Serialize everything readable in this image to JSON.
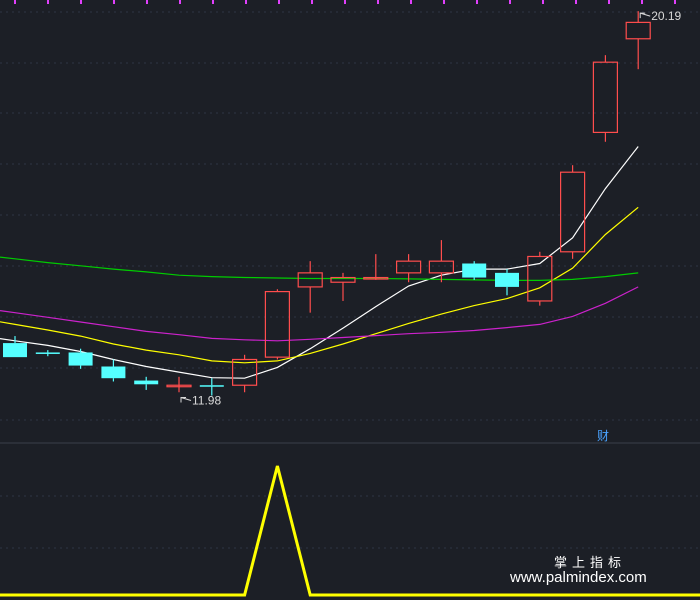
{
  "chart_data": {
    "type": "candlestick",
    "main": {
      "price_range": [
        11.5,
        20.3
      ],
      "candles": [
        {
          "open": 13.1,
          "high": 13.25,
          "low": 12.8,
          "close": 12.8
        },
        {
          "open": 12.9,
          "high": 12.95,
          "low": 12.82,
          "close": 12.88
        },
        {
          "open": 12.9,
          "high": 12.98,
          "low": 12.55,
          "close": 12.62
        },
        {
          "open": 12.6,
          "high": 12.75,
          "low": 12.28,
          "close": 12.35
        },
        {
          "open": 12.3,
          "high": 12.38,
          "low": 12.1,
          "close": 12.22
        },
        {
          "open": 12.2,
          "high": 12.38,
          "low": 12.05,
          "close": 12.2
        },
        {
          "open": 12.2,
          "high": 12.35,
          "low": 11.98,
          "close": 12.19
        },
        {
          "open": 12.2,
          "high": 12.85,
          "low": 12.05,
          "close": 12.75
        },
        {
          "open": 12.8,
          "high": 14.25,
          "low": 12.75,
          "close": 14.2
        },
        {
          "open": 14.3,
          "high": 14.85,
          "low": 13.75,
          "close": 14.6
        },
        {
          "open": 14.4,
          "high": 14.6,
          "low": 14.0,
          "close": 14.5
        },
        {
          "open": 14.5,
          "high": 15.0,
          "low": 14.45,
          "close": 14.5
        },
        {
          "open": 14.6,
          "high": 15.0,
          "low": 14.4,
          "close": 14.85
        },
        {
          "open": 14.6,
          "high": 15.3,
          "low": 14.4,
          "close": 14.85
        },
        {
          "open": 14.8,
          "high": 14.85,
          "low": 14.45,
          "close": 14.5
        },
        {
          "open": 14.6,
          "high": 14.68,
          "low": 14.12,
          "close": 14.3
        },
        {
          "open": 14.0,
          "high": 15.05,
          "low": 13.9,
          "close": 14.95
        },
        {
          "open": 15.05,
          "high": 16.9,
          "low": 14.9,
          "close": 16.75
        },
        {
          "open": 17.6,
          "high": 19.25,
          "low": 17.4,
          "close": 19.1
        },
        {
          "open": 19.6,
          "high": 20.19,
          "low": 18.95,
          "close": 19.95
        }
      ],
      "ma_lines": [
        {
          "color": "#ffffff",
          "values": [
            13.15,
            13.05,
            12.92,
            12.75,
            12.6,
            12.48,
            12.36,
            12.35,
            12.58,
            12.98,
            13.42,
            13.88,
            14.32,
            14.55,
            14.68,
            14.68,
            14.8,
            15.35,
            16.4,
            17.3
          ]
        },
        {
          "open": null,
          "color": "#ffff00",
          "values": [
            13.5,
            13.38,
            13.25,
            13.08,
            12.95,
            12.85,
            12.72,
            12.68,
            12.72,
            12.88,
            13.08,
            13.3,
            13.52,
            13.72,
            13.9,
            14.05,
            14.28,
            14.7,
            15.42,
            16.0
          ]
        },
        {
          "color": "#00cc00",
          "values": [
            14.9,
            14.82,
            14.75,
            14.68,
            14.62,
            14.55,
            14.52,
            14.5,
            14.49,
            14.48,
            14.48,
            14.48,
            14.47,
            14.46,
            14.45,
            14.44,
            14.44,
            14.46,
            14.52,
            14.6
          ]
        },
        {
          "color": "#cc22cc",
          "values": [
            13.75,
            13.65,
            13.55,
            13.45,
            13.35,
            13.28,
            13.2,
            13.17,
            13.15,
            13.18,
            13.22,
            13.26,
            13.3,
            13.33,
            13.37,
            13.43,
            13.5,
            13.67,
            13.95,
            14.3
          ]
        }
      ],
      "annotations": [
        {
          "text": "20.19",
          "candle": 19,
          "price": 20.19,
          "side": "right"
        },
        {
          "text": "11.98",
          "candle": 5,
          "price": 11.98,
          "side": "right"
        }
      ]
    },
    "indicator": {
      "type": "line",
      "color": "#ffff00",
      "values": [
        0,
        0,
        0,
        0,
        0,
        0,
        0,
        0,
        1,
        0,
        0,
        0,
        0,
        0,
        0,
        0,
        0,
        0,
        0,
        0
      ]
    }
  },
  "financial_mark": "财",
  "watermark": {
    "line1": "掌上指标",
    "line2": "www.palmindex.com"
  },
  "colors": {
    "up": "#ff4d4d",
    "down": "#55ffff",
    "indicator": "#ffff00",
    "grid": "#2e3644",
    "background": "#1c1f26",
    "top_marks": "#e040fb",
    "financial_mark": "#4aa3ff"
  }
}
